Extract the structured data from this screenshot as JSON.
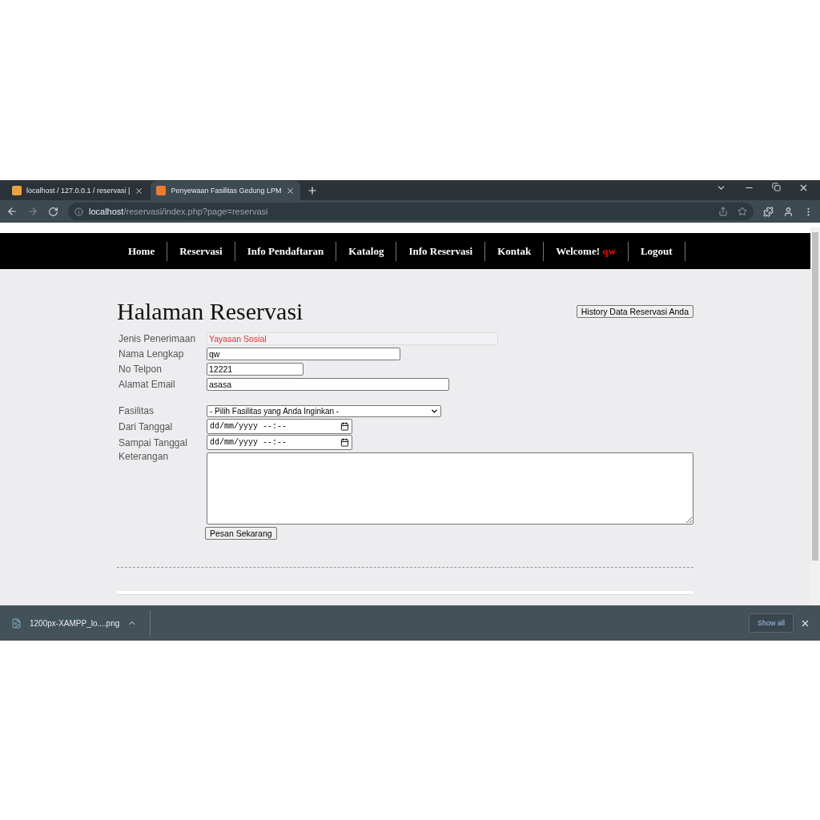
{
  "browser": {
    "tabs": [
      {
        "title": "localhost / 127.0.0.1 / reservasi | ",
        "selected": false
      },
      {
        "title": "Penyewaan Fasilitas Gedung LPM",
        "selected": true
      }
    ],
    "url_host": "localhost",
    "url_path": "/reservasi/index.php?page=reservasi"
  },
  "nav": {
    "items": [
      {
        "label": "Home"
      },
      {
        "label": "Reservasi"
      },
      {
        "label": "Info Pendaftaran"
      },
      {
        "label": "Katalog"
      },
      {
        "label": "Info Reservasi"
      },
      {
        "label": "Kontak"
      },
      {
        "label": "Welcome!",
        "user": "qw"
      },
      {
        "label": "Logout"
      }
    ]
  },
  "page": {
    "title": "Halaman Reservasi",
    "history_button": "History Data Reservasi Anda"
  },
  "form": {
    "fields": [
      {
        "kind": "readonly",
        "label": "Jenis Penerimaan",
        "value": "Yayasan Sosial"
      },
      {
        "kind": "text",
        "label": "Nama Lengkap",
        "value": "qw"
      },
      {
        "kind": "text",
        "label": "No Telpon",
        "value": "12221"
      },
      {
        "kind": "text",
        "label": "Alamat Email",
        "value": "asasa"
      },
      {
        "kind": "select",
        "label": "Fasilitas",
        "value": "- Pilih Fasilitas yang Anda Inginkan -"
      },
      {
        "kind": "date",
        "label": "Dari Tanggal",
        "value": "dd/mm/yyyy --:--"
      },
      {
        "kind": "date",
        "label": "Sampai Tanggal",
        "value": "dd/mm/yyyy --:--"
      },
      {
        "kind": "textarea",
        "label": "Keterangan"
      }
    ],
    "submit": "Pesan Sekarang"
  },
  "downloads": {
    "file": "1200px-XAMPP_lo....png",
    "show_all": "Show all"
  }
}
